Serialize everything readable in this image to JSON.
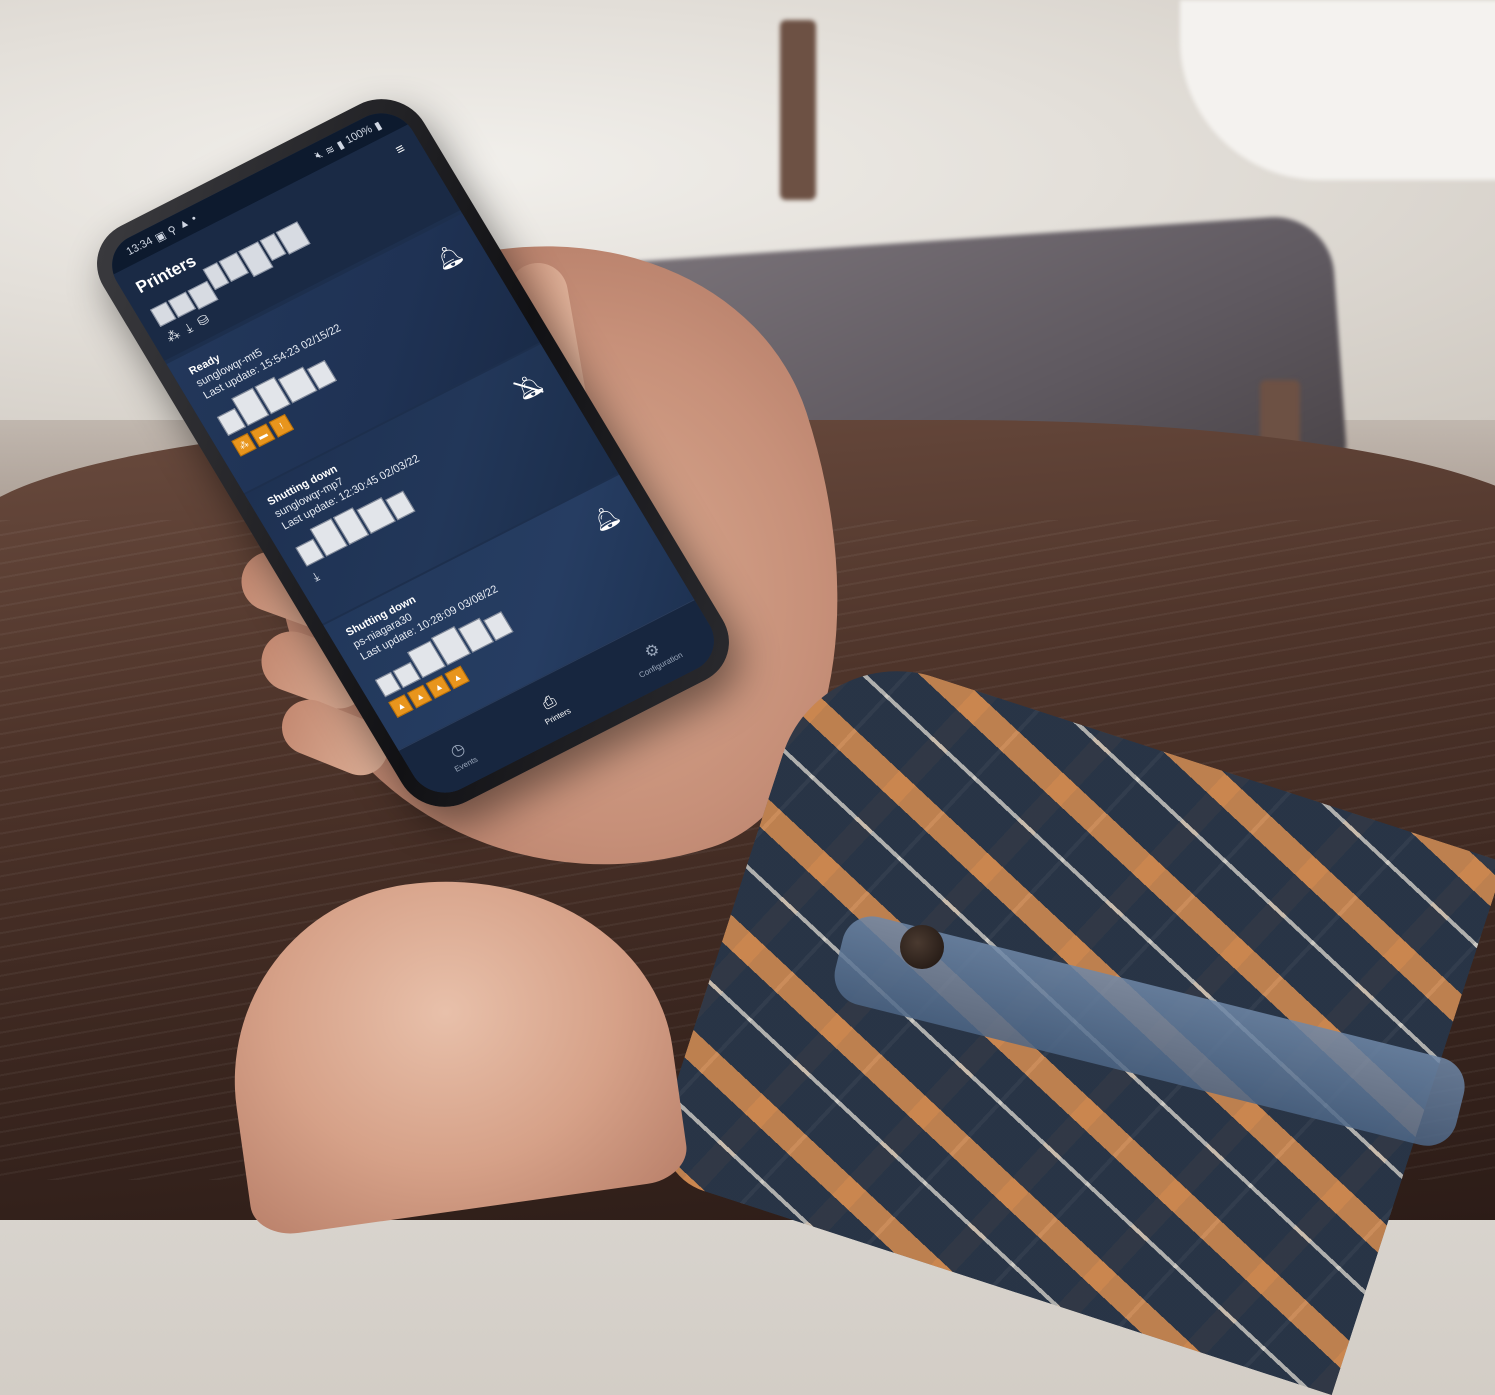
{
  "status_bar": {
    "time": "13:34",
    "left_icons": [
      "image-icon",
      "location-icon",
      "alert-icon"
    ],
    "battery": "100%"
  },
  "header": {
    "title": "Printers",
    "menu_icon": "menu-icon",
    "icons": [
      "toner-icon",
      "staple-icon",
      "stack-icon"
    ]
  },
  "printers": [
    {
      "status": "Ready",
      "name": "sunglowqr-mt5",
      "last_update": "Last update: 15:54:23 02/15/22",
      "bell": "bell-icon",
      "badges": [
        "toner-warning",
        "paper-warning",
        "alert-warning"
      ]
    },
    {
      "status": "Shutting down",
      "name": "sunglowqr-mp7",
      "last_update": "Last update: 12:30:45 02/03/22",
      "bell": "bell-off-icon",
      "badges": []
    },
    {
      "status": "Shutting down",
      "name": "ps-niagara30",
      "last_update": "Last update: 10:28:09 03/08/22",
      "bell": "bell-icon",
      "badges": [
        "warning",
        "warning",
        "warning",
        "warning"
      ]
    }
  ],
  "tabs": [
    {
      "label": "Events",
      "icon": "clock-icon",
      "active": false
    },
    {
      "label": "Printers",
      "icon": "printer-icon",
      "active": true
    },
    {
      "label": "Configuration",
      "icon": "gear-icon",
      "active": false
    }
  ],
  "colors": {
    "screen_bg": "#1d2f4d",
    "warning_badge": "#e8951d",
    "text": "#ffffff"
  }
}
